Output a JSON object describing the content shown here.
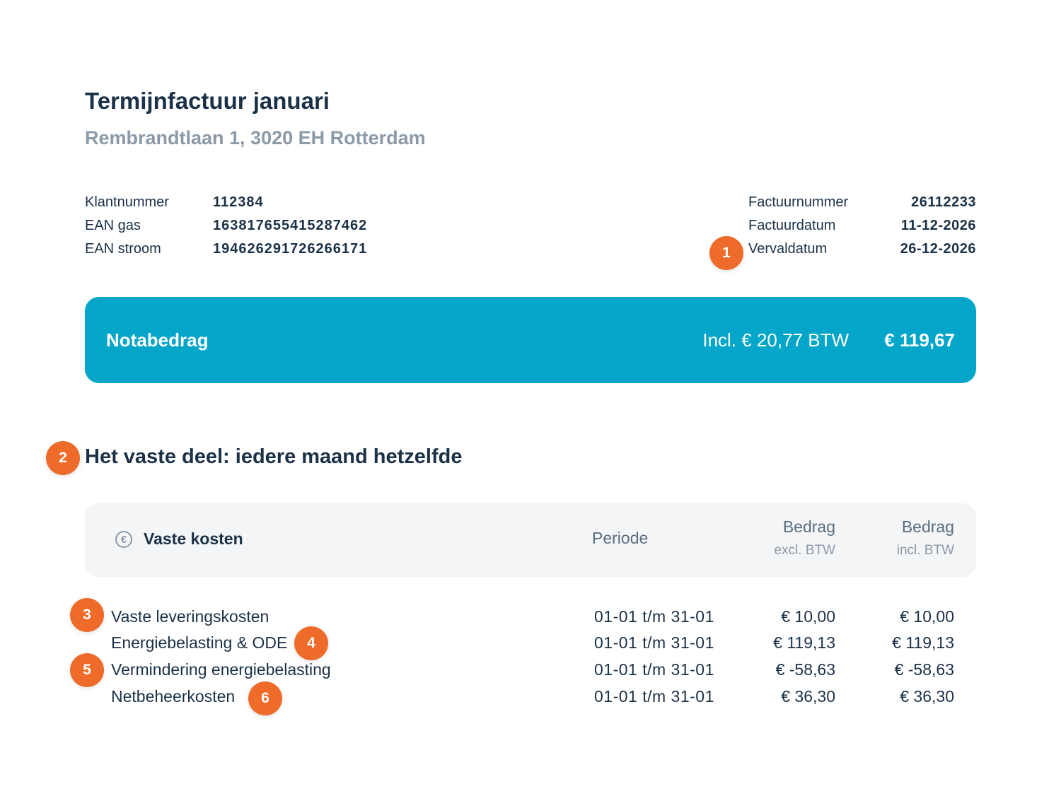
{
  "header": {
    "title": "Termijnfactuur januari",
    "address": "Rembrandtlaan 1, 3020 EH Rotterdam"
  },
  "info_left": [
    {
      "label": "Klantnummer",
      "value": "112384"
    },
    {
      "label": "EAN gas",
      "value": "163817655415287462"
    },
    {
      "label": "EAN stroom",
      "value": "194626291726266171"
    }
  ],
  "info_right": [
    {
      "label": "Factuurnummer",
      "value": "26112233"
    },
    {
      "label": "Factuurdatum",
      "value": "11-12-2026"
    },
    {
      "label": "Vervaldatum",
      "value": "26-12-2026"
    }
  ],
  "total": {
    "label": "Notabedrag",
    "vat": "Incl. € 20,77 BTW",
    "amount": "€ 119,67"
  },
  "section": {
    "title": "Het vaste deel: iedere maand hetzelfde"
  },
  "table": {
    "title": "Vaste kosten",
    "icon": "euro-icon",
    "col_period": "Periode",
    "col_excl_main": "Bedrag",
    "col_excl_sub": "excl. BTW",
    "col_incl_main": "Bedrag",
    "col_incl_sub": "incl. BTW",
    "rows": [
      {
        "name": "Vaste leveringskosten",
        "period": "01-01 t/m 31-01",
        "excl": "€ 10,00",
        "incl": "€ 10,00"
      },
      {
        "name": "Energiebelasting & ODE",
        "period": "01-01 t/m 31-01",
        "excl": "€ 119,13",
        "incl": "€ 119,13"
      },
      {
        "name": "Vermindering energiebelasting",
        "period": "01-01 t/m 31-01",
        "excl": "€ -58,63",
        "incl": "€ -58,63"
      },
      {
        "name": "Netbeheerkosten",
        "period": "01-01 t/m 31-01",
        "excl": "€ 36,30",
        "incl": "€ 36,30"
      }
    ]
  },
  "badges": [
    "1",
    "2",
    "3",
    "4",
    "5",
    "6"
  ],
  "colors": {
    "accent": "#03a5c9",
    "badge": "#ee6b2a",
    "text": "#1b3147",
    "muted": "#8c9aa8"
  }
}
